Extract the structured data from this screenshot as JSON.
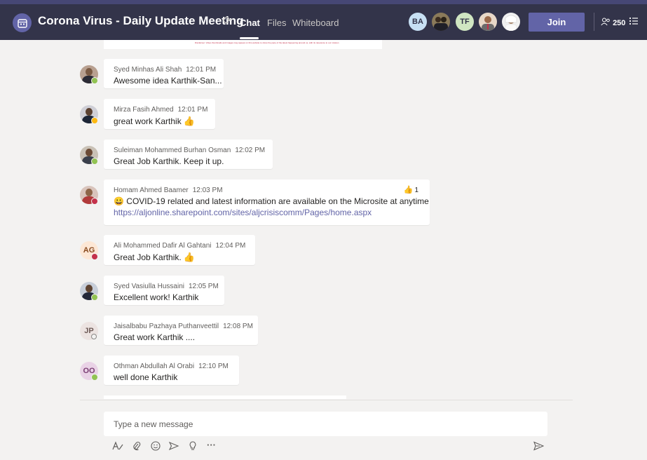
{
  "header": {
    "meeting_title": "Corona Virus - Daily Update Meeting",
    "tabs": [
      {
        "label": "Chat"
      },
      {
        "label": "Files"
      },
      {
        "label": "Whiteboard"
      }
    ],
    "participant_initials": [
      "BA",
      "TF"
    ],
    "join_label": "Join",
    "participant_count": "250"
  },
  "top_message": {
    "disclaimer": "Disclaimer: Video thumbnails and images may appear on this website to show the pace of the latest happening around us, with its relevance to our mission"
  },
  "messages": [
    {
      "author": "Syed Minhas Ali Shah",
      "time": "12:01 PM",
      "text": "Awesome idea Karthik-San...",
      "status": "available"
    },
    {
      "author": "Mirza Fasih Ahmed",
      "time": "12:01 PM",
      "text": "great work Karthik",
      "status": "away",
      "emoji": "thumbs-up"
    },
    {
      "author": "Suleiman Mohammed Burhan Osman",
      "time": "12:02 PM",
      "text": "Great Job Karthik. Keep it up.",
      "status": "available"
    },
    {
      "author": "Homam Ahmed Baamer",
      "time": "12:03 PM",
      "text": "COVID-19 related and latest information are available on the Microsite at anytime",
      "link": "https://aljonline.sharepoint.com/sites/aljcrisiscomm/Pages/home.aspx",
      "reaction_count": "1",
      "status": "busy"
    },
    {
      "author": "Ali Mohammed Dafir Al Gahtani",
      "time": "12:04 PM",
      "text": "Great Job Karthik.",
      "initials": "AG",
      "status": "busy",
      "emoji": "thumbs-up"
    },
    {
      "author": "Syed Vasiulla Hussaini",
      "time": "12:05 PM",
      "text": "Excellent work! Karthik",
      "status": "available"
    },
    {
      "author": "Jaisalbabu Pazhaya Puthanveettil",
      "time": "12:08 PM",
      "text": "Great work Karthik ....",
      "initials": "JP",
      "status": "offline"
    },
    {
      "author": "Othman Abdullah Al Orabi",
      "time": "12:10 PM",
      "text": "well done Karthik",
      "initials": "OO",
      "status": "available"
    }
  ],
  "compose": {
    "placeholder": "Type a new message"
  },
  "colors": {
    "header_bg": "#33344a",
    "accent": "#6264a7",
    "available": "#92c353",
    "away": "#fdb913",
    "busy": "#c4314b"
  }
}
